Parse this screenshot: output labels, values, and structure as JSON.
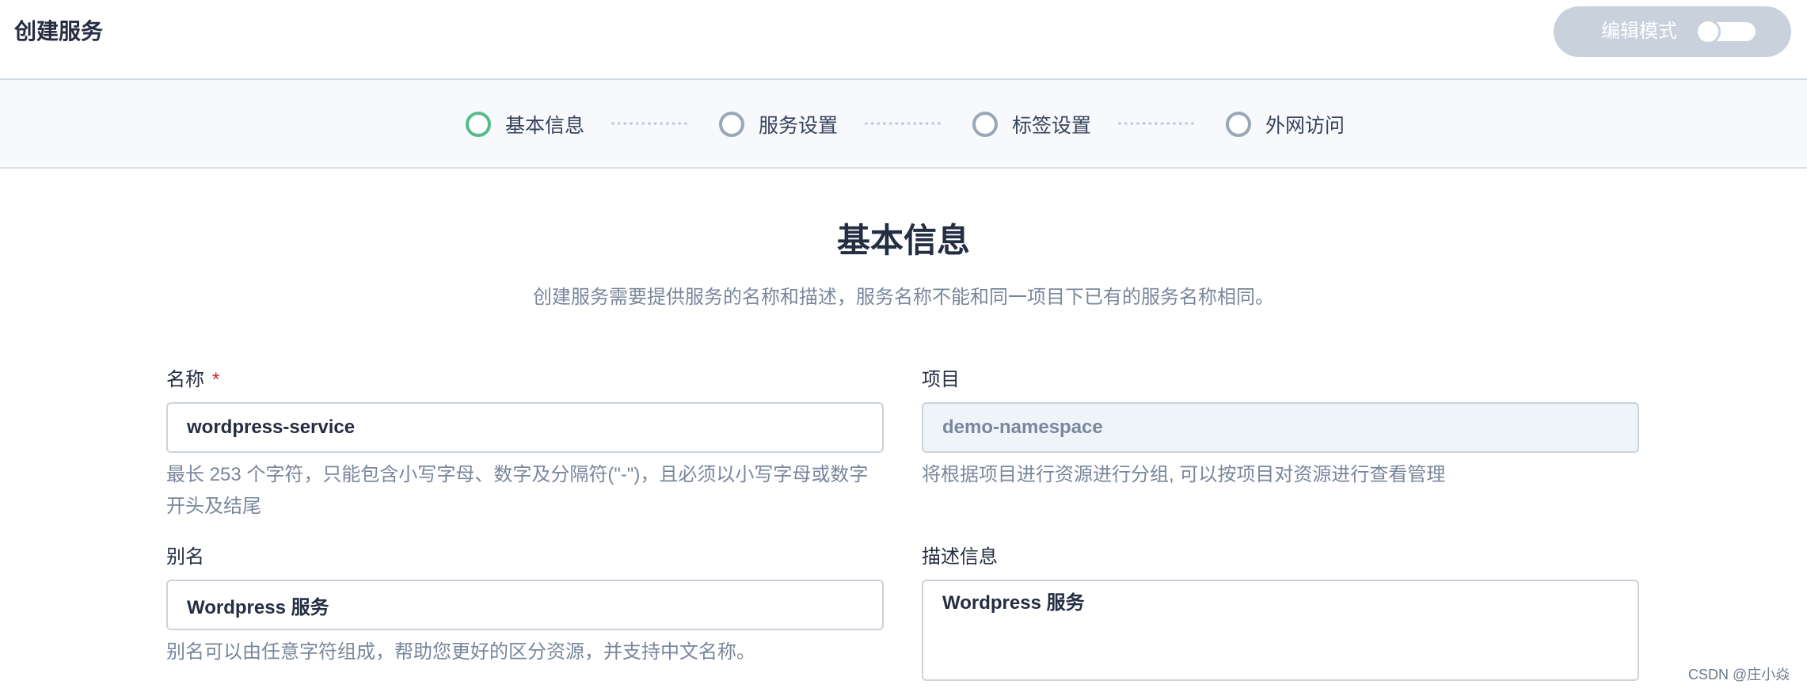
{
  "header": {
    "title": "创建服务",
    "edit_mode_label": "编辑模式"
  },
  "steps": [
    {
      "label": "基本信息",
      "state": "active"
    },
    {
      "label": "服务设置",
      "state": "pending"
    },
    {
      "label": "标签设置",
      "state": "pending"
    },
    {
      "label": "外网访问",
      "state": "pending"
    }
  ],
  "section": {
    "title": "基本信息",
    "description": "创建服务需要提供服务的名称和描述，服务名称不能和同一项目下已有的服务名称相同。"
  },
  "form": {
    "name": {
      "label": "名称",
      "required_mark": "*",
      "value": "wordpress-service",
      "hint_line1": "最长 253 个字符，只能包含小写字母、数字及分隔符(\"-\")，且必须以小写字母或数字",
      "hint_line2": "开头及结尾"
    },
    "project": {
      "label": "项目",
      "value": "demo-namespace",
      "hint": "将根据项目进行资源进行分组, 可以按项目对资源进行查看管理"
    },
    "alias": {
      "label": "别名",
      "value": "Wordpress 服务",
      "hint": "别名可以由任意字符组成，帮助您更好的区分资源，并支持中文名称。"
    },
    "description": {
      "label": "描述信息",
      "value": "Wordpress 服务"
    }
  },
  "watermark": "CSDN @庄小焱",
  "colors": {
    "active_step": "#55bc8a",
    "pending_step": "#9aa7b7",
    "required": "#ca2621",
    "hint_text": "#79879c"
  }
}
